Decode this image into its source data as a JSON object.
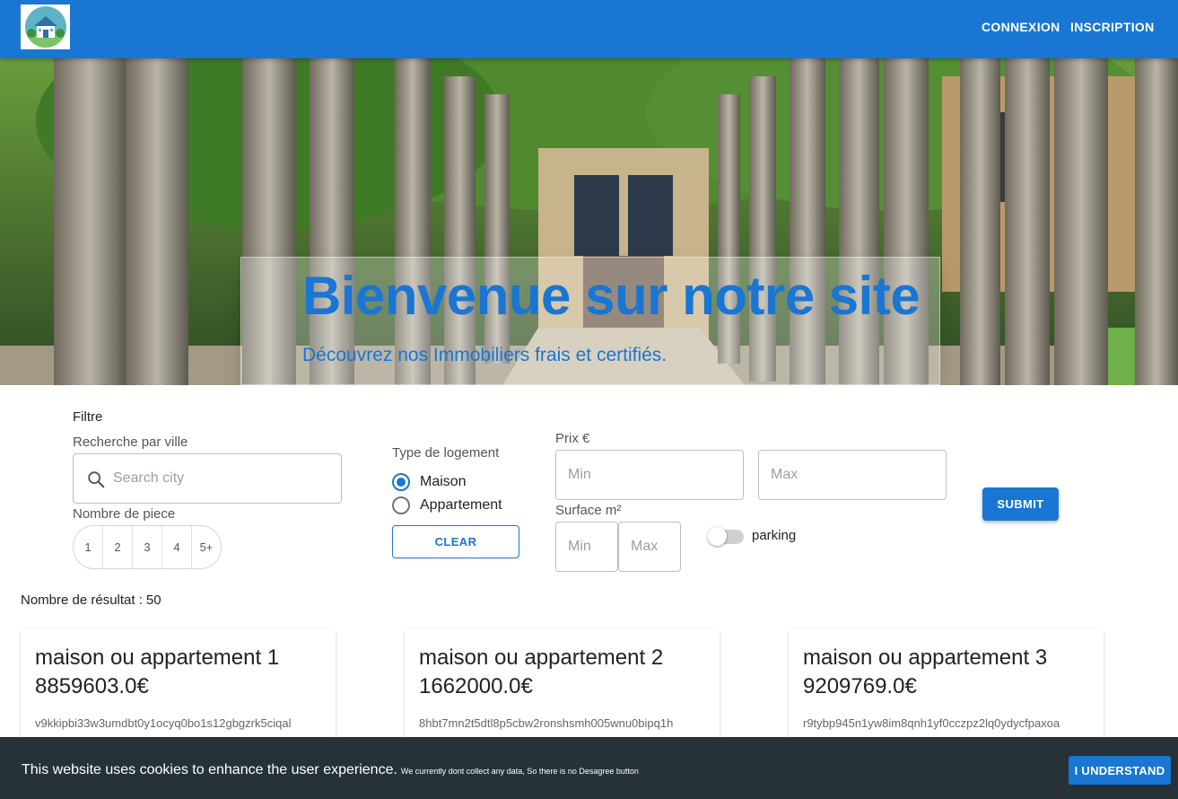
{
  "nav": {
    "login": "CONNEXION",
    "signup": "INSCRIPTION"
  },
  "hero": {
    "title": "Bienvenue sur notre site",
    "subtitle": "Découvrez nos Immobiliers frais et certifiés."
  },
  "filter": {
    "heading": "Filtre",
    "city_label": "Recherche par ville",
    "city_placeholder": "Search city",
    "rooms_label": "Nombre de piece",
    "rooms": [
      "1",
      "2",
      "3",
      "4",
      "5+"
    ],
    "type_label": "Type de logement",
    "types": [
      {
        "label": "Maison",
        "selected": true
      },
      {
        "label": "Appartement",
        "selected": false
      }
    ],
    "clear": "CLEAR",
    "price_label": "Prix €",
    "surface_label": "Surface m²",
    "min_placeholder": "Min",
    "max_placeholder": "Max",
    "parking_label": "parking",
    "parking_on": false,
    "submit": "SUBMIT"
  },
  "results": {
    "label": "Nombre de résultat :",
    "count": "50"
  },
  "cards": [
    {
      "title": "maison ou appartement 1",
      "price": "8859603.0€",
      "id": "v9kkipbi33w3umdbt0y1ocyq0bo1s12gbgzrk5ciqal"
    },
    {
      "title": "maison ou appartement 2",
      "price": "1662000.0€",
      "id": "8hbt7mn2t5dtl8p5cbw2ronshsmh005wnu0bipq1h"
    },
    {
      "title": "maison ou appartement 3",
      "price": "9209769.0€",
      "id": "r9tybp945n1yw8im8qnh1yf0cczpz2lq0ydycfpaxoa"
    }
  ],
  "cookie": {
    "text": "This website uses cookies to enhance the user experience.",
    "small": "We currently dont collect any data, So there is no Desagree button",
    "button": "I UNDERSTAND"
  },
  "colors": {
    "primary": "#1976d2",
    "banner": "#263238"
  }
}
